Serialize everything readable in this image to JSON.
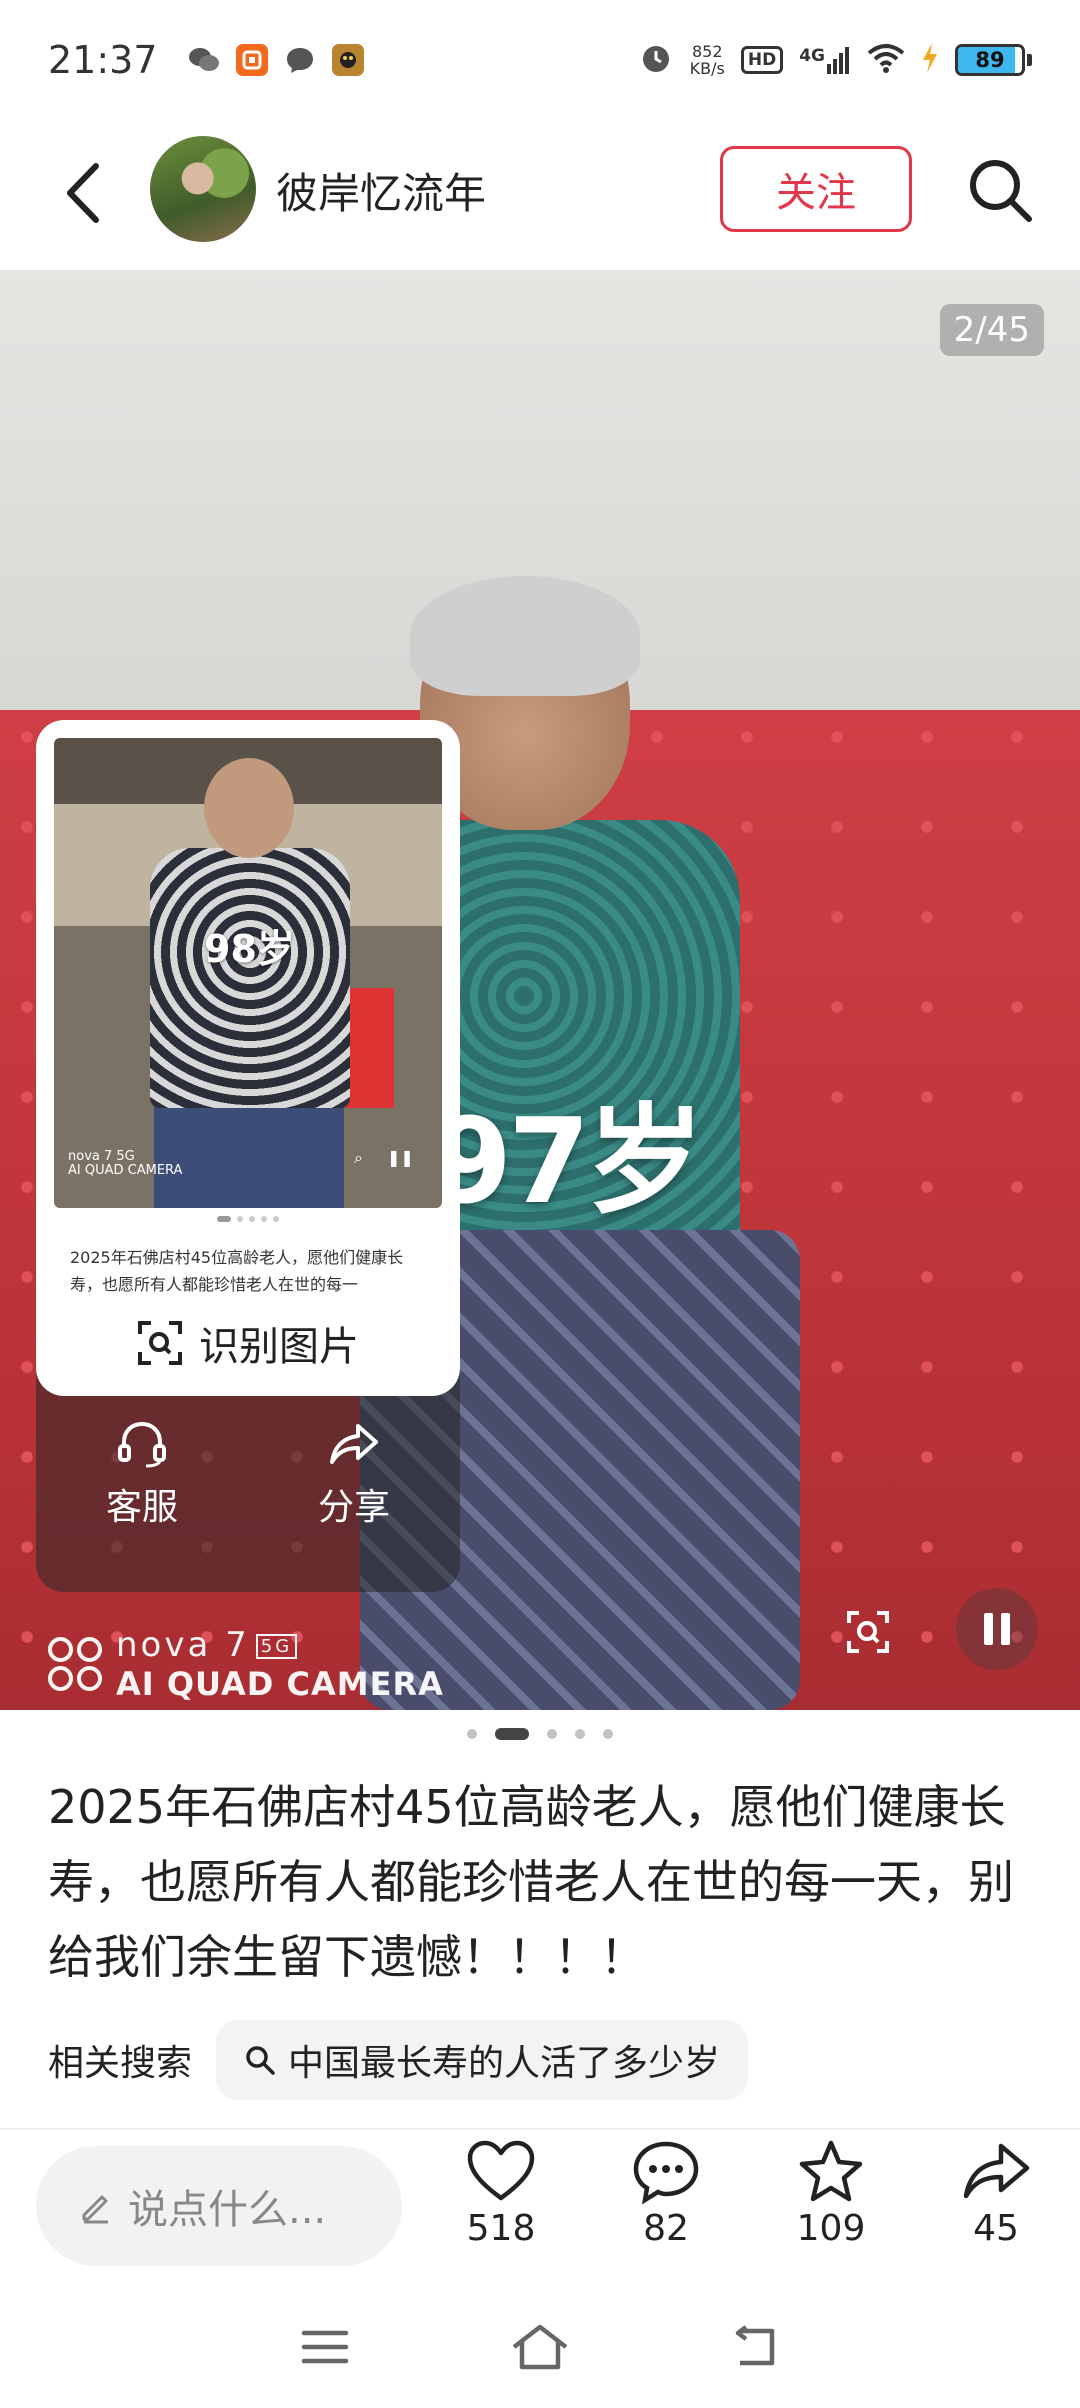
{
  "status_bar": {
    "time": "21:37",
    "notifications": [
      "wechat-icon",
      "app-icon",
      "message-icon",
      "game-icon"
    ],
    "net_speed_value": "852",
    "net_speed_unit": "KB/s",
    "hd_label": "HD",
    "network_label": "4G",
    "battery": "89",
    "battery_level": 0.89
  },
  "header": {
    "username": "彼岸忆流年",
    "follow_label": "关注"
  },
  "post": {
    "counter": "2/45",
    "overlay_age": "97岁",
    "watermark_line1": "nova 7",
    "watermark_badge": "5G",
    "watermark_line2": "AI QUAD CAMERA",
    "description": "2025年石佛店村45位高龄老人，愿他们健康长寿，也愿所有人都能珍惜老人在世的每一天，别给我们余生留下遗憾！！！！",
    "related_label": "相关搜索",
    "related_query": "中国最长寿的人活了多少岁"
  },
  "popup": {
    "thumb_age": "98岁",
    "thumb_wm_line1": "nova 7 5G",
    "thumb_wm_line2": "AI QUAD CAMERA",
    "text": "2025年石佛店村45位高龄老人，愿他们健康长寿，也愿所有人都能珍惜老人在世的每一",
    "identify_label": "识别图片",
    "service_label": "客服",
    "share_label": "分享"
  },
  "bottom_bar": {
    "comment_placeholder": "说点什么...",
    "likes": "518",
    "comments": "82",
    "stars": "109",
    "shares": "45"
  },
  "colors": {
    "accent": "#e2374a",
    "battery": "#3db8ee"
  }
}
